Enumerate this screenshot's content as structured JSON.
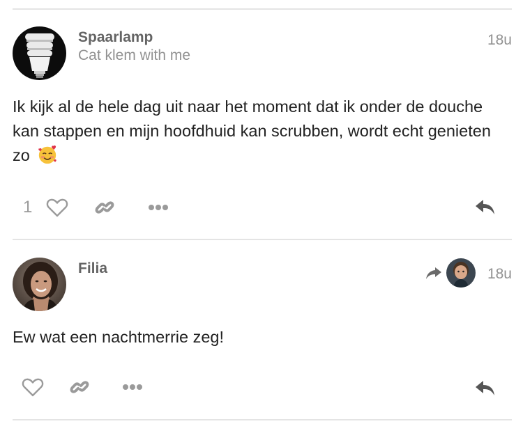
{
  "posts": [
    {
      "username": "Spaarlamp",
      "user_title": "Cat klem with me",
      "time": "18u",
      "text": "Ik kijk al de hele dag uit naar het moment dat ik onder de douche kan stappen en mijn hoofdhuid kan scrubben, wordt echt genieten zo",
      "emoji": "smiling-face-with-hearts",
      "like_count": "1",
      "avatar_icon": "light-bulb-icon"
    },
    {
      "username": "Filia",
      "time": "18u",
      "text": "Ew wat een nachtmerrie zeg!",
      "like_count": "",
      "avatar_icon": "user-photo",
      "reply_to_icon": "reply-arrow-icon"
    }
  ],
  "colors": {
    "icon_gray": "#9a9a9a",
    "reply_gray": "#666666",
    "divider": "#e4e4e4",
    "name_gray": "#646464",
    "meta_gray": "#919191"
  }
}
